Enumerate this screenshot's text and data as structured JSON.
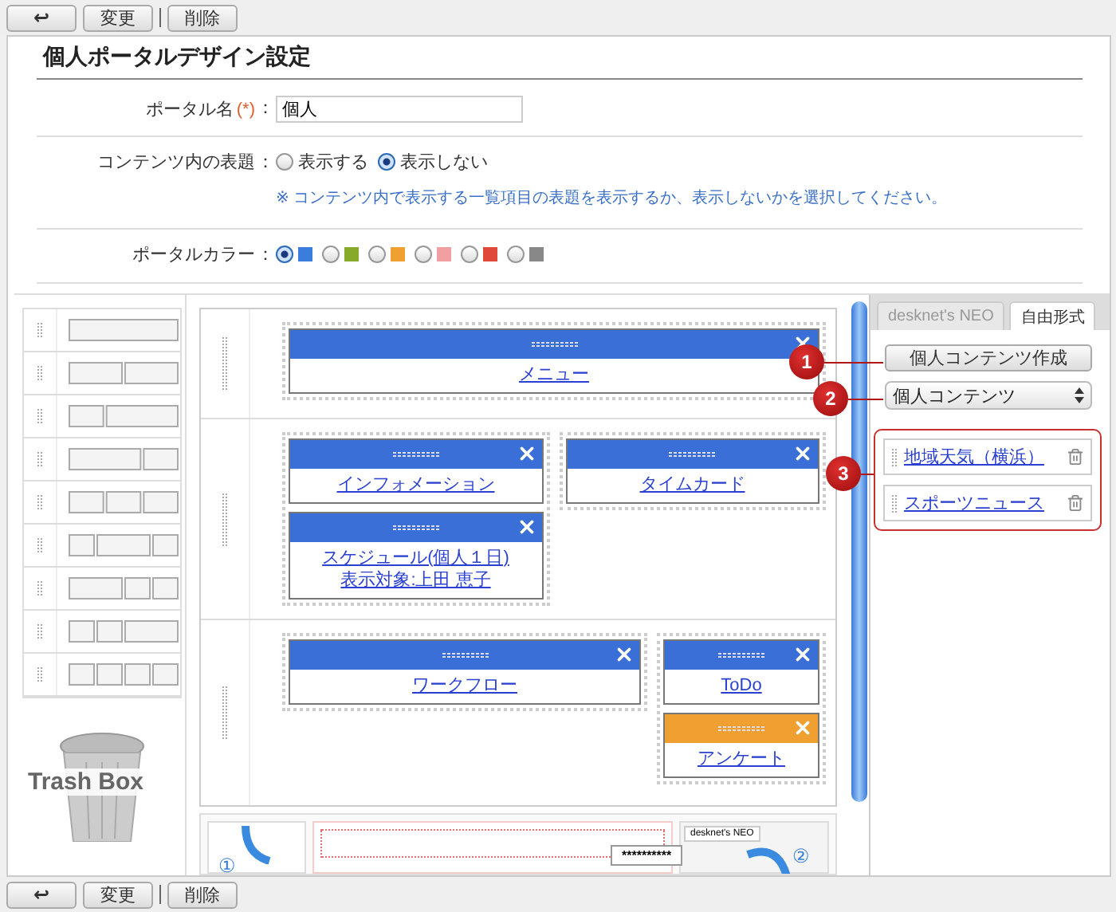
{
  "toolbar_top": {
    "back": "↩",
    "buttons": [
      "変更",
      "削除"
    ]
  },
  "title": "個人ポータルデザイン設定",
  "form": {
    "name_label": "ポータル名",
    "required_mark": "(*)",
    "colon": "：",
    "name_value": "個人",
    "heading_label": "コンテンツ内の表題",
    "heading_options": [
      {
        "label": "表示する",
        "selected": false
      },
      {
        "label": "表示しない",
        "selected": true
      }
    ],
    "heading_note": "※ コンテンツ内で表示する一覧項目の表題を表示するか、表示しないかを選択してください。",
    "color_label": "ポータルカラー",
    "colors": [
      {
        "color": "#3b7ddd",
        "selected": true
      },
      {
        "color": "#88aa2a",
        "selected": false
      },
      {
        "color": "#f0a030",
        "selected": false
      },
      {
        "color": "#f0a0a0",
        "selected": false
      },
      {
        "color": "#e0483a",
        "selected": false
      },
      {
        "color": "#888888",
        "selected": false
      }
    ]
  },
  "trash_label": "Trash Box",
  "canvas_rows": [
    {
      "kind": "single",
      "columns": [
        [
          {
            "lines": [
              "メニュー"
            ],
            "color": "#3b6fd8"
          }
        ]
      ]
    },
    {
      "kind": "half",
      "columns": [
        [
          {
            "lines": [
              "インフォメーション"
            ],
            "color": "#3b6fd8"
          },
          {
            "lines": [
              "スケジュール(個人１日)",
              "表示対象:上田 恵子"
            ],
            "color": "#3b6fd8"
          }
        ],
        [
          {
            "lines": [
              "タイムカード"
            ],
            "color": "#3b6fd8"
          }
        ]
      ]
    },
    {
      "kind": "wide-narrow",
      "columns": [
        [
          {
            "lines": [
              "ワークフロー"
            ],
            "color": "#3b6fd8"
          }
        ],
        [
          {
            "lines": [
              "ToDo"
            ],
            "color": "#3b6fd8"
          },
          {
            "lines": [
              "アンケート"
            ],
            "color": "#f0a030"
          }
        ]
      ]
    }
  ],
  "side": {
    "tabs": [
      {
        "label": "desknet's NEO",
        "selected": false
      },
      {
        "label": "自由形式",
        "selected": true
      }
    ],
    "create_button": "個人コンテンツ作成",
    "select_value": "個人コンテンツ",
    "items": [
      "地域天気（横浜）",
      "スポーツニュース"
    ]
  },
  "callouts": [
    "1",
    "2",
    "3"
  ],
  "illustration": {
    "tab": "desknet's NEO",
    "masked": "**********",
    "step_1": "①",
    "step_2": "②"
  },
  "toolbar_bottom": {
    "back": "↩",
    "buttons": [
      "変更",
      "削除"
    ]
  }
}
